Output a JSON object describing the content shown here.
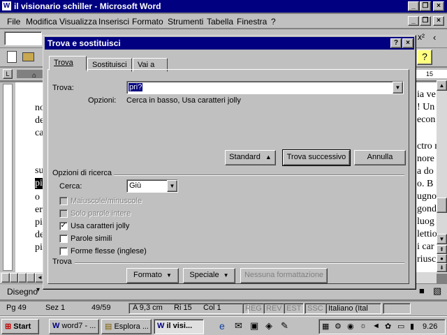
{
  "window": {
    "title": "il visionario schiller - Microsoft Word",
    "menu": [
      "File",
      "Modifica",
      "Visualizza",
      "Inserisci",
      "Formato",
      "Strumenti",
      "Tabella",
      "Finestra",
      "?"
    ]
  },
  "ruler": {
    "right_mark": "15"
  },
  "document": {
    "left_fragments": [
      "no",
      "de",
      "ca",
      "su",
      "pi",
      "o",
      "er",
      "pi",
      "de",
      "pi"
    ],
    "right_fragments": [
      "ia ve",
      "! Un",
      "econ",
      "ctro n",
      "nore",
      "a do",
      "o. B",
      "ugno",
      "gond",
      "luog",
      "lettio",
      "i car",
      "riusc"
    ]
  },
  "drawbar": {
    "label": "Disegno"
  },
  "status": {
    "page": "Pg 49",
    "section": "Sez 1",
    "pages": "49/59",
    "at": "A 9,3 cm",
    "line": "Ri 15",
    "col": "Col 1",
    "rec": "REG",
    "rev": "REV",
    "ext": "EST",
    "ovr": "SSC",
    "language": "Italiano (Ital"
  },
  "taskbar": {
    "start": "Start",
    "tasks": [
      "word7 - ...",
      "Esplora ...",
      "il visi..."
    ],
    "clock": "9.26"
  },
  "dialog": {
    "title": "Trova e sostituisci",
    "tabs": [
      "Trova",
      "Sostituisci",
      "Vai a"
    ],
    "find_label": "Trova:",
    "find_value": "pri?",
    "options_label": "Opzioni:",
    "options_value": "Cerca in basso, Usa caratteri jolly",
    "btn_standard": "Standard",
    "btn_find_next": "Trova successivo",
    "btn_cancel": "Annulla",
    "search_options_title": "Opzioni di ricerca",
    "search_label": "Cerca:",
    "search_value": "Giù",
    "checkboxes": [
      {
        "label": "Maiuscole/minuscole",
        "checked": false,
        "enabled": false
      },
      {
        "label": "Solo parole intere",
        "checked": false,
        "enabled": false
      },
      {
        "label": "Usa caratteri jolly",
        "checked": true,
        "enabled": true
      },
      {
        "label": "Parole simili",
        "checked": false,
        "enabled": true
      },
      {
        "label": "Forme flesse (inglese)",
        "checked": false,
        "enabled": true
      }
    ],
    "find_section_title": "Trova",
    "btn_format": "Formato",
    "btn_special": "Speciale",
    "btn_no_format": "Nessuna formattazione"
  }
}
